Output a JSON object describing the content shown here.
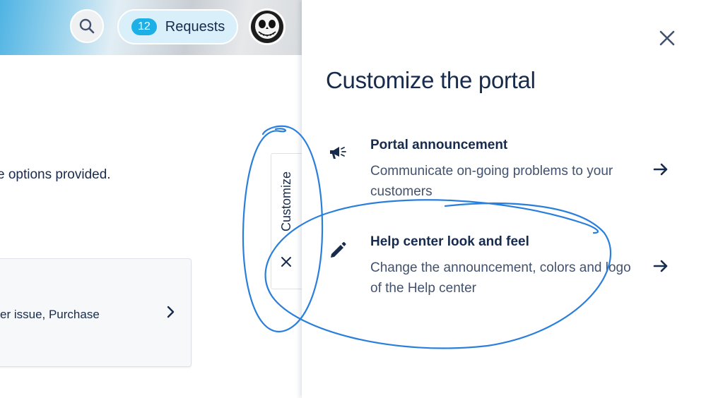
{
  "header": {
    "search_icon": "search-icon",
    "requests": {
      "count": "12",
      "label": "Requests"
    },
    "avatar_icon": "skull-avatar"
  },
  "background_page": {
    "instruction_text": "e options provided.",
    "card_text": "er issue, Purchase"
  },
  "customize_tab": {
    "label": "Customize",
    "close_icon": "close-icon"
  },
  "drawer": {
    "title": "Customize the portal",
    "options": [
      {
        "title": "Portal announcement",
        "description": "Communicate on-going problems to your customers",
        "icon": "megaphone-icon"
      },
      {
        "title": "Help center look and feel",
        "description": "Change the announcement, colors and logo of the Help center",
        "icon": "pencil-icon"
      }
    ]
  },
  "colors": {
    "accent": "#1cb0e6",
    "text": "#172b4d",
    "annotation": "#2a7fdc"
  }
}
